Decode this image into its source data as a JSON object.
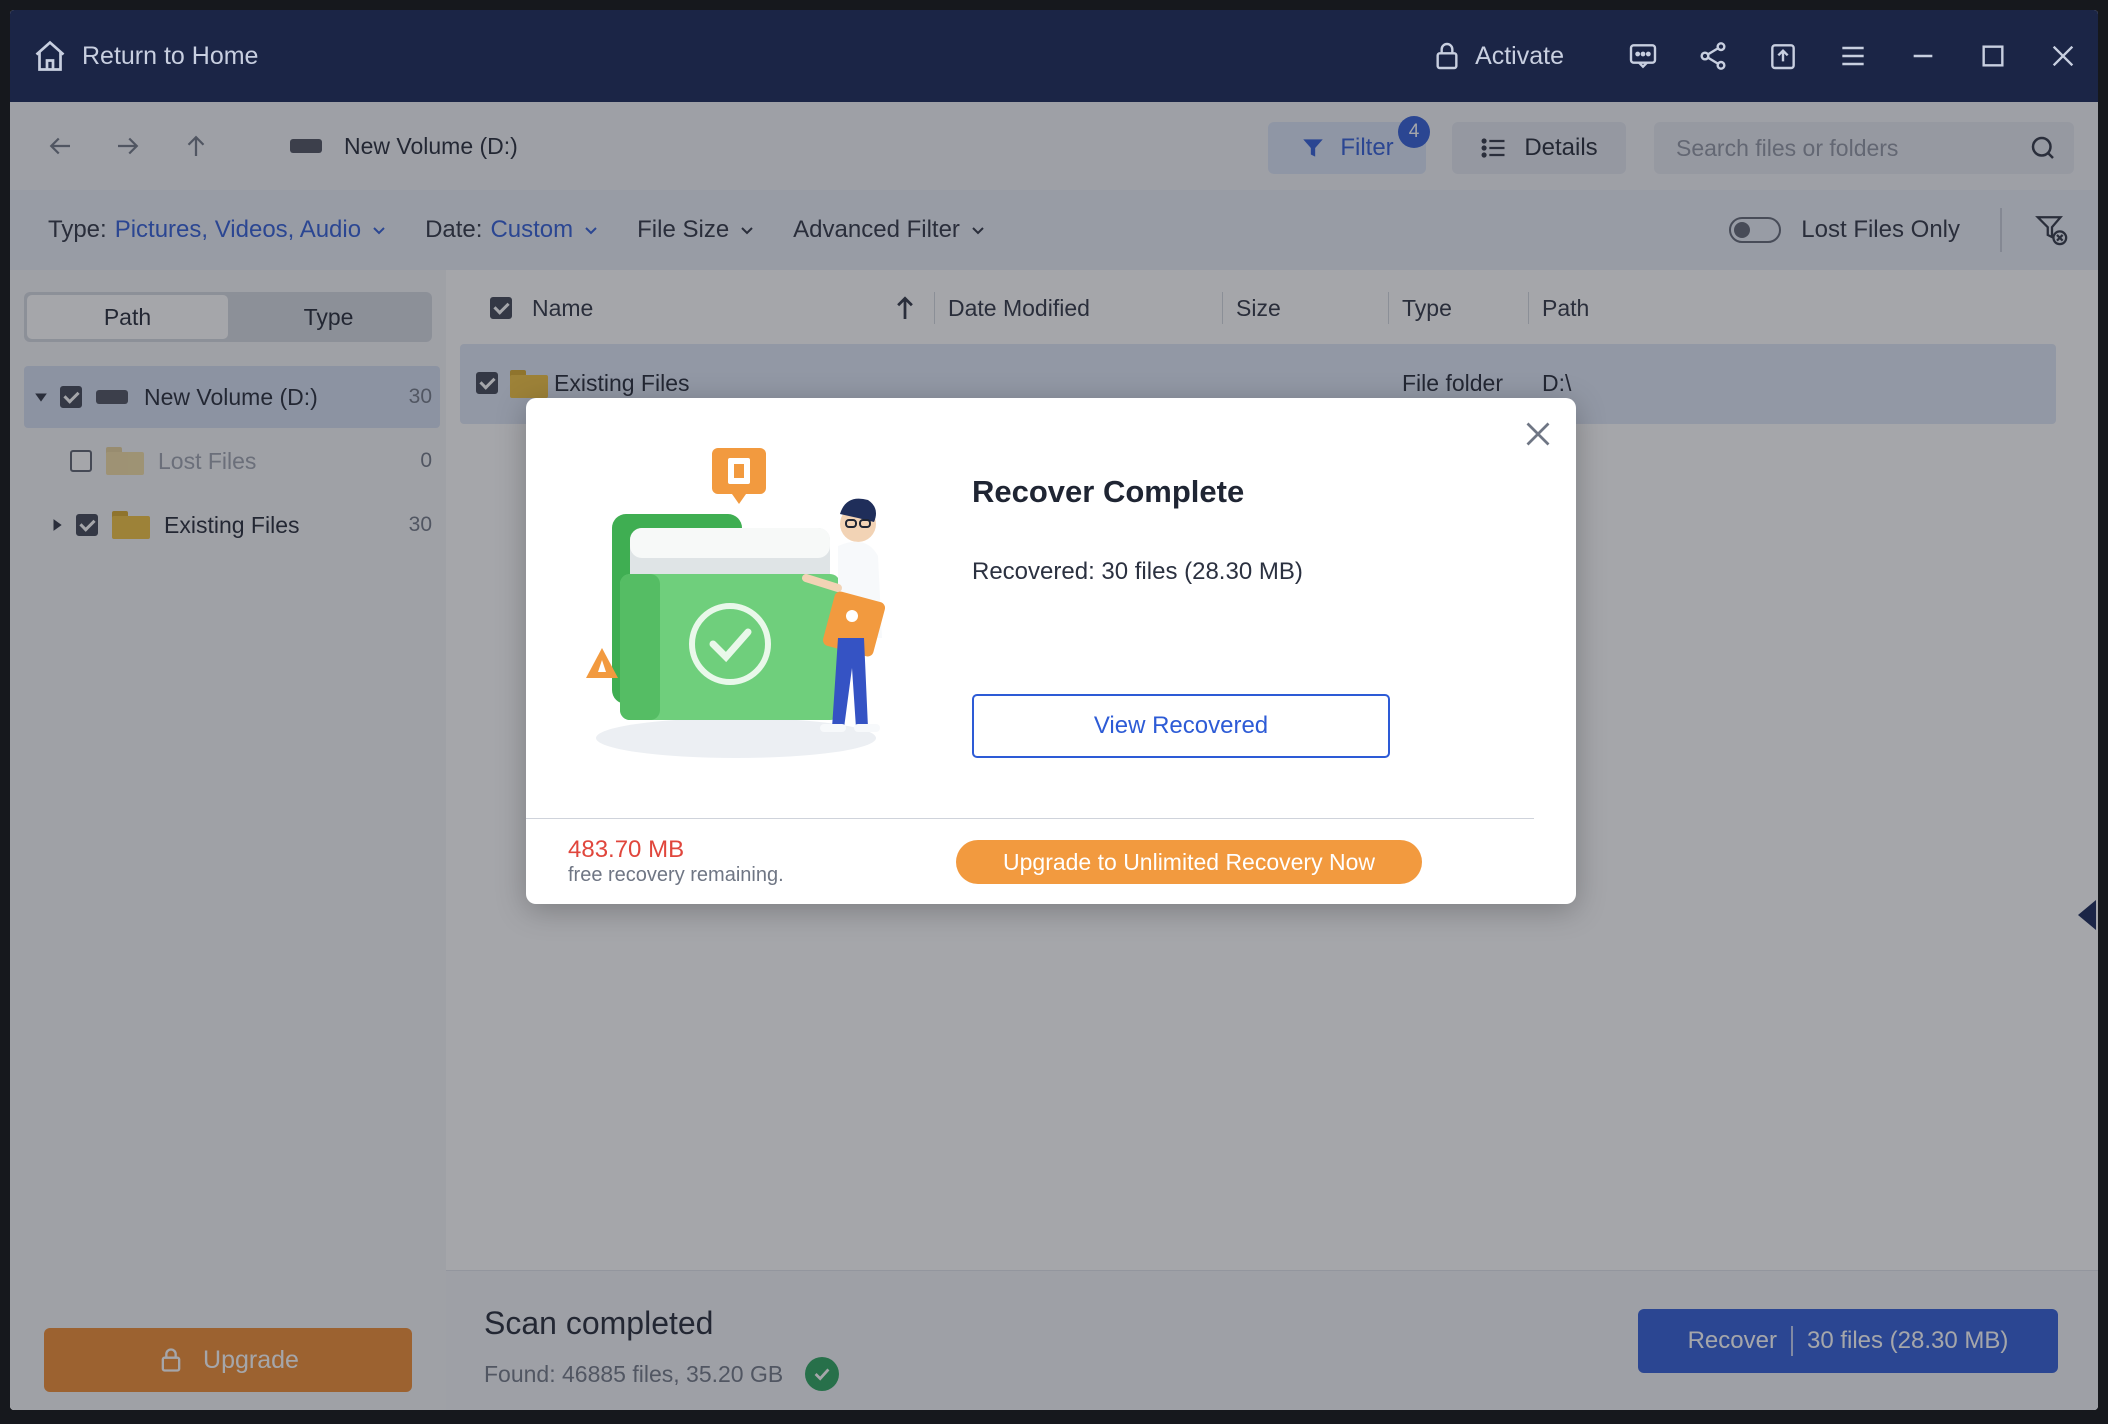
{
  "titlebar": {
    "home_label": "Return to Home",
    "activate_label": "Activate",
    "icons": [
      "chat-icon",
      "share-icon",
      "export-icon",
      "menu-icon",
      "minimize-icon",
      "maximize-icon",
      "close-icon"
    ]
  },
  "toolbar": {
    "location": "New Volume (D:)",
    "filter_label": "Filter",
    "filter_count": "4",
    "details_label": "Details",
    "search_placeholder": "Search files or folders"
  },
  "filterbar": {
    "type_label": "Type:",
    "type_value": "Pictures, Videos, Audio",
    "date_label": "Date:",
    "date_value": "Custom",
    "size_label": "File Size",
    "advanced_label": "Advanced Filter",
    "lost_only_label": "Lost Files Only"
  },
  "sidebar": {
    "tabs": [
      "Path",
      "Type"
    ],
    "tree": [
      {
        "label": "New Volume (D:)",
        "count": "30"
      },
      {
        "label": "Lost Files",
        "count": "0"
      },
      {
        "label": "Existing Files",
        "count": "30"
      }
    ],
    "upgrade_label": "Upgrade"
  },
  "table": {
    "columns": [
      "Name",
      "Date Modified",
      "Size",
      "Type",
      "Path"
    ],
    "rows": [
      {
        "name": "Existing Files",
        "type": "File folder",
        "path": "D:\\"
      }
    ]
  },
  "bottom": {
    "scan_title": "Scan completed",
    "scan_found": "Found: 46885 files, 35.20 GB",
    "recover_label": "Recover",
    "recover_detail": "30 files (28.30 MB)"
  },
  "modal": {
    "title": "Recover Complete",
    "recovered_text": "Recovered: 30 files (28.30 MB)",
    "view_label": "View Recovered",
    "remaining_mb": "483.70 MB",
    "remaining_text": "free recovery remaining.",
    "upgrade_label": "Upgrade to Unlimited Recovery Now"
  },
  "colors": {
    "titlebar": "#1b2546",
    "accent": "#2d5bd6",
    "upgrade": "#f08a2e",
    "warning": "#e0463c",
    "success": "#27a35a"
  }
}
